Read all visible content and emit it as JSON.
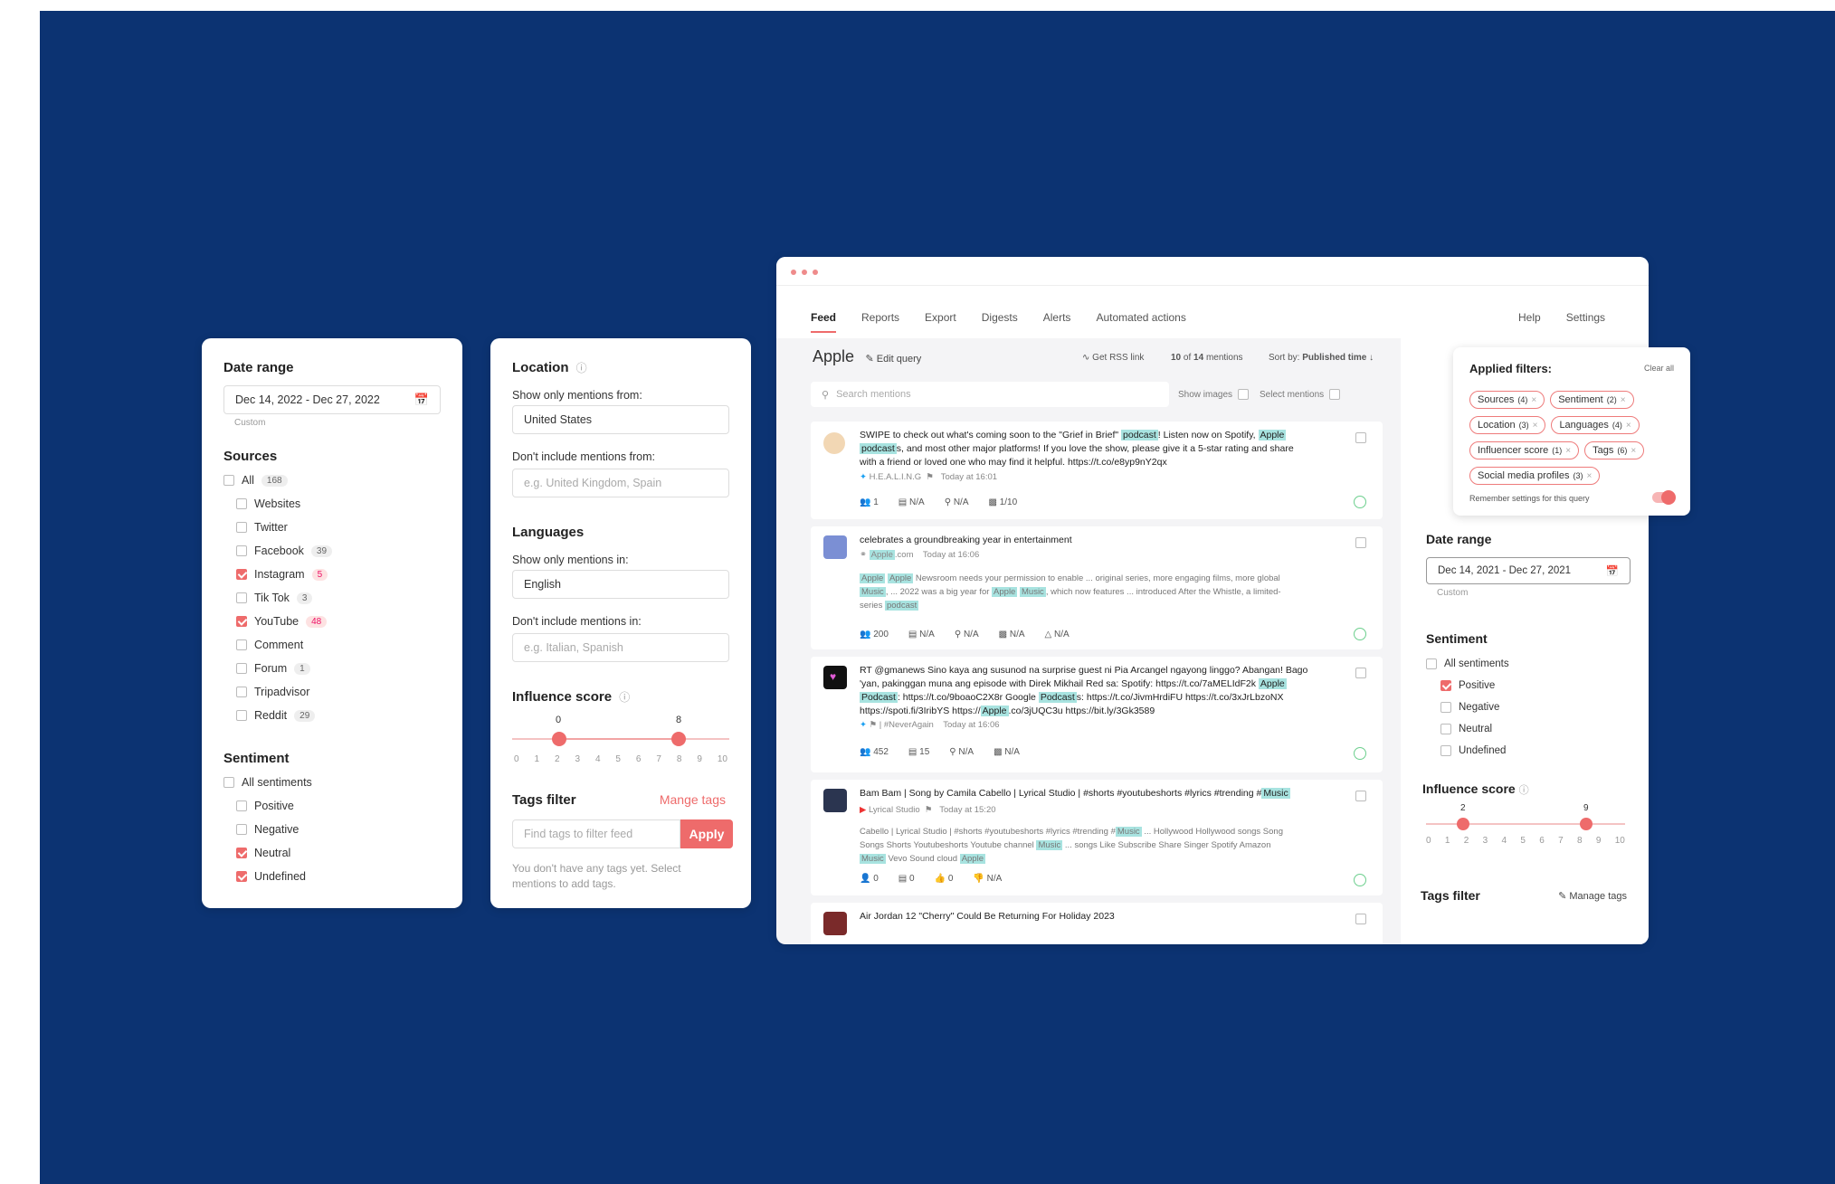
{
  "left_panel": {
    "date_range": {
      "title": "Date range",
      "value": "Dec 14, 2022 - Dec 27, 2022",
      "sub": "Custom"
    },
    "sources": {
      "title": "Sources",
      "items": [
        {
          "label": "All",
          "count": "168",
          "checked": false,
          "red": false
        },
        {
          "label": "Websites",
          "count": "",
          "checked": false,
          "red": false
        },
        {
          "label": "Twitter",
          "count": "",
          "checked": false,
          "red": false
        },
        {
          "label": "Facebook",
          "count": "39",
          "checked": false,
          "red": false
        },
        {
          "label": "Instagram",
          "count": "5",
          "checked": true,
          "red": true
        },
        {
          "label": "Tik Tok",
          "count": "3",
          "checked": false,
          "red": false
        },
        {
          "label": "YouTube",
          "count": "48",
          "checked": true,
          "red": true
        },
        {
          "label": "Comment",
          "count": "",
          "checked": false,
          "red": false
        },
        {
          "label": "Forum",
          "count": "1",
          "checked": false,
          "red": false
        },
        {
          "label": "Tripadvisor",
          "count": "",
          "checked": false,
          "red": false
        },
        {
          "label": "Reddit",
          "count": "29",
          "checked": false,
          "red": false
        }
      ]
    },
    "sentiment": {
      "title": "Sentiment",
      "items": [
        {
          "label": "All sentiments",
          "checked": false
        },
        {
          "label": "Positive",
          "checked": false
        },
        {
          "label": "Negative",
          "checked": false
        },
        {
          "label": "Neutral",
          "checked": true
        },
        {
          "label": "Undefined",
          "checked": true
        }
      ]
    }
  },
  "middle_panel": {
    "location": {
      "title": "Location",
      "only_label": "Show only mentions from:",
      "only_value": "United States",
      "exclude_label": "Don't include mentions from:",
      "exclude_placeholder": "e.g. United Kingdom, Spain"
    },
    "languages": {
      "title": "Languages",
      "only_label": "Show only mentions in:",
      "only_value": "English",
      "exclude_label": "Don't include mentions in:",
      "exclude_placeholder": "e.g. Italian, Spanish"
    },
    "influence": {
      "title": "Influence score",
      "low": "0",
      "high": "8",
      "low_value": 2,
      "high_value": 8,
      "ticks": [
        "0",
        "1",
        "2",
        "3",
        "4",
        "5",
        "6",
        "7",
        "8",
        "9",
        "10"
      ]
    },
    "tags": {
      "title": "Tags filter",
      "manage": "Mange tags",
      "placeholder": "Find tags to filter feed",
      "apply": "Apply",
      "empty": "You don't have any tags yet. Select mentions to add tags."
    }
  },
  "app": {
    "nav": [
      "Feed",
      "Reports",
      "Export",
      "Digests",
      "Alerts",
      "Automated actions"
    ],
    "nav_right": [
      "Help",
      "Settings"
    ],
    "query": "Apple",
    "edit_query": "Edit query",
    "rss": "Get RSS link",
    "count_prefix": "10",
    "count_mid": "of",
    "count_total": "14",
    "count_suffix": "mentions",
    "sort_label": "Sort by:",
    "sort_value": "Published time",
    "search_placeholder": "Search mentions",
    "show_images": "Show images",
    "select_mentions": "Select mentions",
    "mentions": [
      {
        "title_parts": [
          "SWIPE to check out what's coming soon to the \"Grief in Brief\" ",
          "podcast",
          "! Listen now on Spotify, ",
          "Apple"
        ],
        "line2_parts": [
          "podcast",
          "s, and most other major platforms! If you love the show, please give it a 5-star rating and share"
        ],
        "line3": "with a friend or loved one who may find it helpful. https://t.co/e8yp9nY2qx",
        "source": "H.E.A.L.I.N.G",
        "time": "Today at 16:01",
        "stats": [
          "1",
          "N/A",
          "N/A",
          "1/10"
        ]
      },
      {
        "title": "celebrates a groundbreaking year in entertainment",
        "source_parts": [
          "Apple",
          ".com"
        ],
        "time": "Today at 16:06",
        "body1_parts": [
          "Apple",
          "Apple",
          " Newsroom needs your permission to enable ... original series, more engaging films, more global"
        ],
        "body2_parts": [
          "Music",
          ", ... 2022 was a big year for ",
          "Apple",
          "Music",
          ", which now features ... introduced After the Whistle, a limited-"
        ],
        "body3_parts": [
          "series ",
          "podcast"
        ],
        "stats": [
          "200",
          "N/A",
          "N/A",
          "N/A",
          "N/A"
        ]
      },
      {
        "line1": "RT @gmanews Sino kaya ang susunod na surprise guest ni Pia Arcangel ngayong linggo? Abangan! Bago",
        "line2_parts": [
          "'yan, pakinggan muna ang episode with Direk Mikhail Red sa: Spotify: https://t.co/7aMELIdF2k ",
          "Apple"
        ],
        "line3_parts": [
          "Podcast",
          ": https://t.co/9boaoC2X8r Google ",
          "Podcast",
          "s: https://t.co/JivmHrdiFU https://t.co/3xJrLbzoNX"
        ],
        "line4_parts": [
          "https://spoti.fi/3IribYS https://",
          "Apple",
          ".co/3jUQC3u https://bit.ly/3Gk3589"
        ],
        "source": "#NeverAgain",
        "time": "Today at 16:06",
        "stats": [
          "452",
          "15",
          "N/A",
          "N/A"
        ]
      },
      {
        "title_parts": [
          "Bam Bam | Song by Camila Cabello | Lyrical Studio | #shorts #youtubeshorts #lyrics #trending #",
          "Music"
        ],
        "source": "Lyrical Studio",
        "time": "Today at 15:20",
        "body1_parts": [
          "Cabello | Lyrical Studio | #shorts #youtubeshorts #lyrics #trending #",
          "Music",
          " ... Hollywood Hollywood songs Song"
        ],
        "body2_parts": [
          "Songs Shorts Youtubeshorts Youtube channel ",
          "Music",
          " ... songs Like Subscribe Share Singer Spotify Amazon"
        ],
        "body3_parts": [
          "Music",
          " Vevo Sound cloud ",
          "Apple"
        ],
        "stats": [
          "0",
          "0",
          "0",
          "N/A"
        ]
      },
      {
        "title": "Air Jordan 12 \"Cherry\" Could Be Returning For Holiday 2023"
      }
    ],
    "applied": {
      "title": "Applied filters:",
      "clear": "Clear all",
      "chips": [
        {
          "label": "Sources",
          "n": "(4)"
        },
        {
          "label": "Sentiment",
          "n": "(2)"
        },
        {
          "label": "Location",
          "n": "(3)"
        },
        {
          "label": "Languages",
          "n": "(4)"
        },
        {
          "label": "Influencer score",
          "n": "(1)"
        },
        {
          "label": "Tags",
          "n": "(6)"
        },
        {
          "label": "Social media profiles",
          "n": "(3)"
        }
      ],
      "remember": "Remember settings for this query"
    },
    "right": {
      "date_title": "Date range",
      "date_value": "Dec 14, 2021 - Dec 27, 2021",
      "date_sub": "Custom",
      "sent_title": "Sentiment",
      "sent_items": [
        {
          "label": "All sentiments",
          "checked": false
        },
        {
          "label": "Positive",
          "checked": true
        },
        {
          "label": "Negative",
          "checked": false
        },
        {
          "label": "Neutral",
          "checked": false
        },
        {
          "label": "Undefined",
          "checked": false
        }
      ],
      "infl_title": "Influence score",
      "low": "2",
      "high": "9",
      "low_value": 2,
      "high_value": 9,
      "ticks": [
        "0",
        "1",
        "2",
        "3",
        "4",
        "5",
        "6",
        "7",
        "8",
        "9",
        "10"
      ],
      "tags_title": "Tags filter",
      "manage": "Manage tags"
    }
  },
  "colors": {
    "bg": "#0c3372",
    "accent": "#ee6b6b",
    "highlight": "#a8e3e0"
  }
}
